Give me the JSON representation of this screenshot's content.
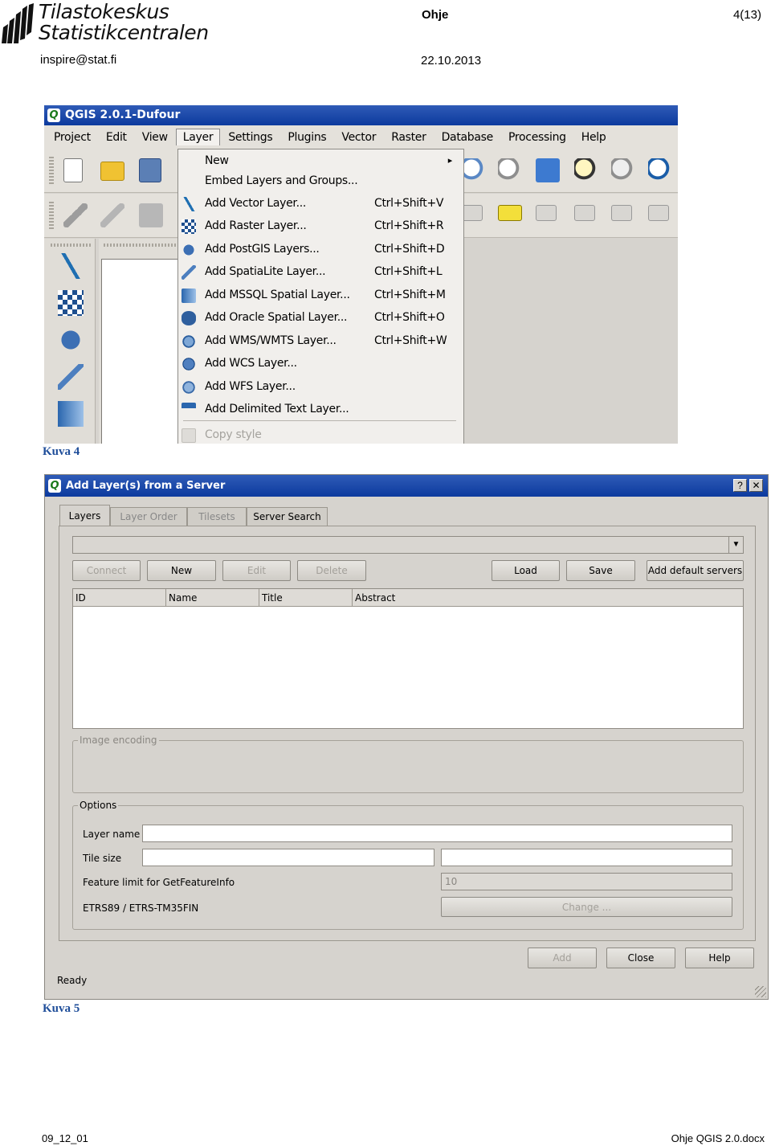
{
  "header": {
    "logo_line1": "Tilastokeskus",
    "logo_line2": "Statistikcentralen",
    "email": "inspire@stat.fi",
    "doc_title": "Ohje",
    "page": "4(13)",
    "date": "22.10.2013"
  },
  "figure4": {
    "window_title": "QGIS 2.0.1-Dufour",
    "menu": [
      "Project",
      "Edit",
      "View",
      "Layer",
      "Settings",
      "Plugins",
      "Vector",
      "Raster",
      "Database",
      "Processing",
      "Help"
    ],
    "layer_menu": [
      {
        "label": "New",
        "shortcut": "",
        "icon": "",
        "submenu_arrow": "▸"
      },
      {
        "label": "Embed Layers and Groups...",
        "shortcut": "",
        "icon": ""
      },
      {
        "label": "Add Vector Layer...",
        "shortcut": "Ctrl+Shift+V",
        "icon": "add-vector-layer-icon"
      },
      {
        "label": "Add Raster Layer...",
        "shortcut": "Ctrl+Shift+R",
        "icon": "add-raster-layer-icon"
      },
      {
        "label": "Add PostGIS Layers...",
        "shortcut": "Ctrl+Shift+D",
        "icon": "add-postgis-layer-icon"
      },
      {
        "label": "Add SpatiaLite Layer...",
        "shortcut": "Ctrl+Shift+L",
        "icon": "add-spatialite-layer-icon"
      },
      {
        "label": "Add MSSQL Spatial Layer...",
        "shortcut": "Ctrl+Shift+M",
        "icon": "add-mssql-layer-icon"
      },
      {
        "label": "Add Oracle Spatial Layer...",
        "shortcut": "Ctrl+Shift+O",
        "icon": "add-oracle-layer-icon"
      },
      {
        "label": "Add WMS/WMTS Layer...",
        "shortcut": "Ctrl+Shift+W",
        "icon": "add-wms-layer-icon"
      },
      {
        "label": "Add WCS Layer...",
        "shortcut": "",
        "icon": "add-wcs-layer-icon"
      },
      {
        "label": "Add WFS Layer...",
        "shortcut": "",
        "icon": "add-wfs-layer-icon"
      },
      {
        "label": "Add Delimited Text Layer...",
        "shortcut": "",
        "icon": "add-delimited-text-layer-icon"
      }
    ],
    "copy_style": "Copy style",
    "caption": "Kuva 4"
  },
  "figure5": {
    "window_title": "Add Layer(s) from a Server",
    "title_help": "?",
    "title_close": "✕",
    "tabs": [
      "Layers",
      "Layer Order",
      "Tilesets",
      "Server Search"
    ],
    "combo_arrow": "▼",
    "buttons": {
      "connect": "Connect",
      "new": "New",
      "edit": "Edit",
      "delete": "Delete",
      "load": "Load",
      "save": "Save",
      "add_default": "Add default servers"
    },
    "columns": [
      "ID",
      "Name",
      "Title",
      "Abstract"
    ],
    "image_encoding_label": "Image encoding",
    "options_label": "Options",
    "layer_name_label": "Layer name",
    "tile_size_label": "Tile size",
    "feature_limit_label": "Feature limit for GetFeatureInfo",
    "feature_limit_value": "10",
    "crs_label": "ETRS89 / ETRS-TM35FIN",
    "change_button": "Change ...",
    "add_button": "Add",
    "close_button": "Close",
    "help_button": "Help",
    "status": "Ready",
    "caption": "Kuva 5"
  },
  "footer": {
    "left": "09_12_01",
    "right": "Ohje QGIS 2.0.docx"
  },
  "colors": {
    "titlebar": "#0c3a9e",
    "caption": "#1f4e9a",
    "window_bg": "#d6d3ce"
  }
}
